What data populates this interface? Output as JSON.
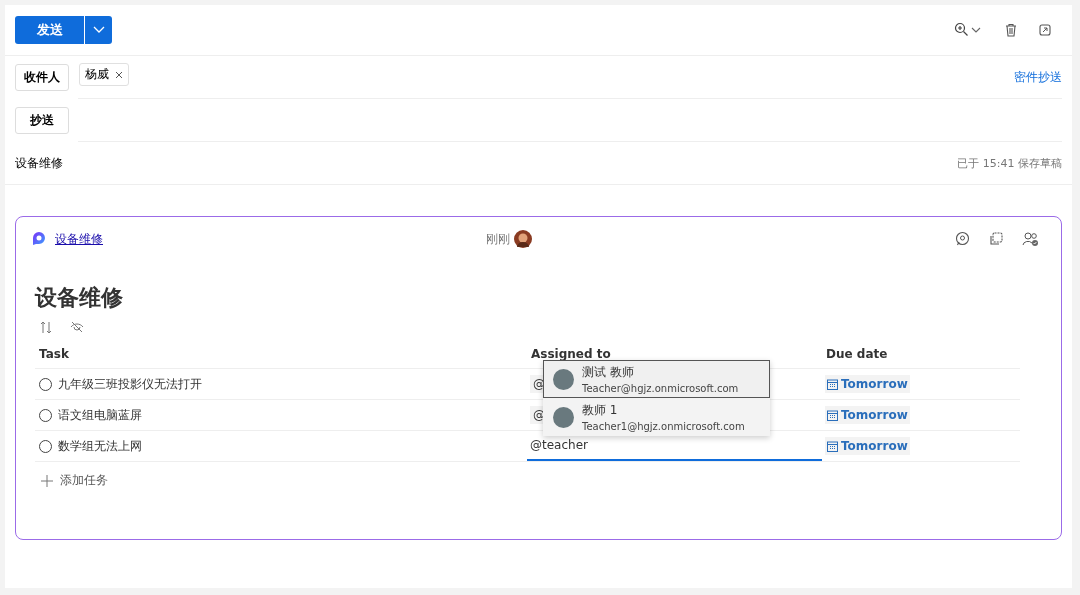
{
  "toolbar": {
    "send_label": "发送"
  },
  "recipients": {
    "to_label": "收件人",
    "to": [
      {
        "name": "杨威"
      }
    ],
    "bcc_link": "密件抄送",
    "cc_label": "抄送"
  },
  "subject": "设备维修",
  "save_status": "已于 15:41 保存草稿",
  "card": {
    "link": "设备维修",
    "time": "刚刚",
    "title": "设备维修",
    "table": {
      "columns": [
        "Task",
        "Assigned to",
        "Due date"
      ],
      "rows": [
        {
          "task": "九年级三班投影仪无法打开",
          "assigned": "@",
          "due": "Tomorrow",
          "editing": false,
          "checked": false
        },
        {
          "task": "语文组电脑蓝屏",
          "assigned": "@",
          "due": "Tomorrow",
          "editing": false,
          "checked": false
        },
        {
          "task": "数学组无法上网",
          "assigned": "@teacher",
          "due": "Tomorrow",
          "editing": true,
          "checked": false
        }
      ]
    },
    "add_task": "添加任务",
    "suggestions": [
      {
        "name": "测试 教师",
        "email": "Teacher@hgjz.onmicrosoft.com",
        "selected": true
      },
      {
        "name": "教师 1",
        "email": "Teacher1@hgjz.onmicrosoft.com",
        "selected": false
      }
    ]
  }
}
